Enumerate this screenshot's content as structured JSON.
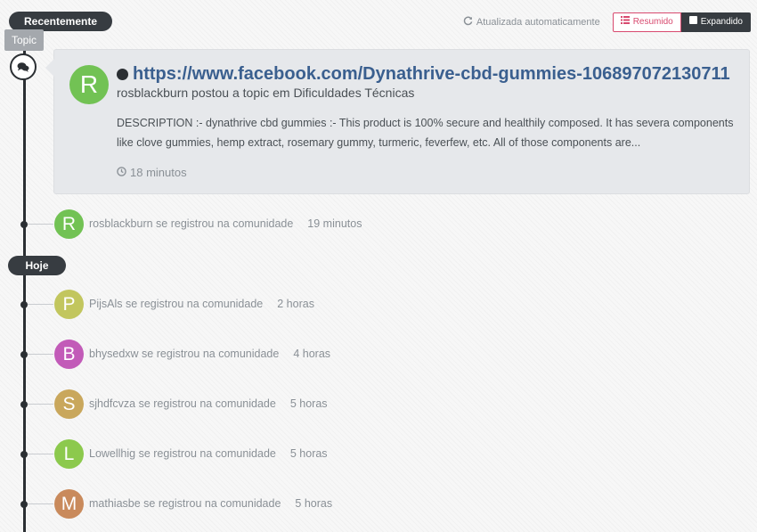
{
  "header": {
    "section_recent": "Recentemente",
    "auto_update": "Atualizada automaticamente",
    "summary_button": "Resumido",
    "expanded_button": "Expandido"
  },
  "topic_tag": "Topic",
  "topic_card": {
    "avatar_letter": "R",
    "avatar_color": "#72c254",
    "title": "https://www.facebook.com/Dynathrive-cbd-gummies-106897072130711",
    "subtitle": "rosblackburn postou a topic em Dificuldades Técnicas",
    "description": "DESCRIPTION :- dynathrive cbd gummies :- This product is 100% secure and healthily composed. It has severa components like clove gummies, hemp extract, rosemary gummy, turmeric, feverfew, etc. All of those components are...",
    "time": "18 minutos"
  },
  "section_today": "Hoje",
  "recent_items": [
    {
      "letter": "R",
      "color": "#72c254",
      "text": "rosblackburn se registrou na comunidade",
      "time": "19 minutos"
    }
  ],
  "today_items": [
    {
      "letter": "P",
      "color": "#c2c65e",
      "text": "PijsAls se registrou na comunidade",
      "time": "2 horas"
    },
    {
      "letter": "B",
      "color": "#c25bb8",
      "text": "bhysedxw se registrou na comunidade",
      "time": "4 horas"
    },
    {
      "letter": "S",
      "color": "#c9a75c",
      "text": "sjhdfcvza se registrou na comunidade",
      "time": "5 horas"
    },
    {
      "letter": "L",
      "color": "#8cc94d",
      "text": "Lowellhig se registrou na comunidade",
      "time": "5 horas"
    },
    {
      "letter": "M",
      "color": "#c98a5c",
      "text": "mathiasbe se registrou na comunidade",
      "time": "5 horas"
    }
  ]
}
